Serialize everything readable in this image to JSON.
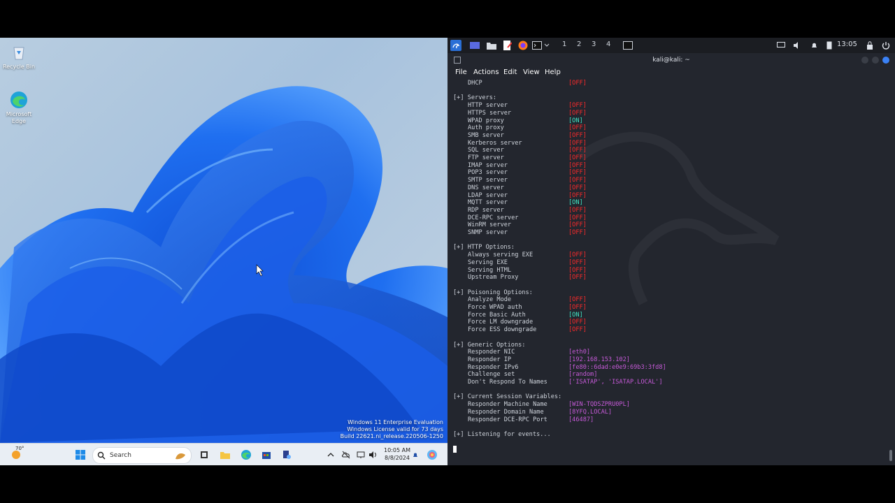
{
  "windows": {
    "desktop_icons": [
      {
        "label": "Recycle Bin",
        "icon": "recycle-bin-icon"
      },
      {
        "label": "Microsoft Edge",
        "icon": "edge-icon"
      }
    ],
    "watermark": [
      "Windows 11 Enterprise Evaluation",
      "Windows License valid for 73 days",
      "Build 22621.ni_release.220506-1250"
    ],
    "taskbar": {
      "weather_temp": "70°",
      "search_placeholder": "Search",
      "time": "10:05 AM",
      "date": "8/8/2024"
    }
  },
  "kali": {
    "topbar": {
      "workspaces": [
        "1",
        "2",
        "3",
        "4"
      ],
      "time": "13:05"
    },
    "window_title": "kali@kali: ~",
    "menu": [
      "File",
      "Actions",
      "Edit",
      "View",
      "Help"
    ],
    "terminal": {
      "first_line": {
        "name": "DHCP",
        "state": "[OFF]"
      },
      "sections": [
        {
          "title": "[+] Servers:",
          "items": [
            {
              "name": "HTTP server",
              "state": "[OFF]"
            },
            {
              "name": "HTTPS server",
              "state": "[OFF]"
            },
            {
              "name": "WPAD proxy",
              "state": "[ON]"
            },
            {
              "name": "Auth proxy",
              "state": "[OFF]"
            },
            {
              "name": "SMB server",
              "state": "[OFF]"
            },
            {
              "name": "Kerberos server",
              "state": "[OFF]"
            },
            {
              "name": "SQL server",
              "state": "[OFF]"
            },
            {
              "name": "FTP server",
              "state": "[OFF]"
            },
            {
              "name": "IMAP server",
              "state": "[OFF]"
            },
            {
              "name": "POP3 server",
              "state": "[OFF]"
            },
            {
              "name": "SMTP server",
              "state": "[OFF]"
            },
            {
              "name": "DNS server",
              "state": "[OFF]"
            },
            {
              "name": "LDAP server",
              "state": "[OFF]"
            },
            {
              "name": "MQTT server",
              "state": "[ON]"
            },
            {
              "name": "RDP server",
              "state": "[OFF]"
            },
            {
              "name": "DCE-RPC server",
              "state": "[OFF]"
            },
            {
              "name": "WinRM server",
              "state": "[OFF]"
            },
            {
              "name": "SNMP server",
              "state": "[OFF]"
            }
          ]
        },
        {
          "title": "[+] HTTP Options:",
          "items": [
            {
              "name": "Always serving EXE",
              "state": "[OFF]"
            },
            {
              "name": "Serving EXE",
              "state": "[OFF]"
            },
            {
              "name": "Serving HTML",
              "state": "[OFF]"
            },
            {
              "name": "Upstream Proxy",
              "state": "[OFF]"
            }
          ]
        },
        {
          "title": "[+] Poisoning Options:",
          "items": [
            {
              "name": "Analyze Mode",
              "state": "[OFF]"
            },
            {
              "name": "Force WPAD auth",
              "state": "[OFF]"
            },
            {
              "name": "Force Basic Auth",
              "state": "[ON]"
            },
            {
              "name": "Force LM downgrade",
              "state": "[OFF]"
            },
            {
              "name": "Force ESS downgrade",
              "state": "[OFF]"
            }
          ]
        },
        {
          "title": "[+] Generic Options:",
          "items": [
            {
              "name": "Responder NIC",
              "state": "[eth0]"
            },
            {
              "name": "Responder IP",
              "state": "[192.168.153.102]"
            },
            {
              "name": "Responder IPv6",
              "state": "[fe80::6dad:e0e9:69b3:3fd8]"
            },
            {
              "name": "Challenge set",
              "state": "[random]"
            },
            {
              "name": "Don't Respond To Names",
              "state": "['ISATAP', 'ISATAP.LOCAL']"
            }
          ]
        },
        {
          "title": "[+] Current Session Variables:",
          "items": [
            {
              "name": "Responder Machine Name",
              "state": "[WIN-TQDSZPRU0PL]"
            },
            {
              "name": "Responder Domain Name",
              "state": "[8YFQ.LOCAL]"
            },
            {
              "name": "Responder DCE-RPC Port",
              "state": "[46487]"
            }
          ]
        }
      ],
      "last_line": "[+] Listening for events..."
    }
  }
}
